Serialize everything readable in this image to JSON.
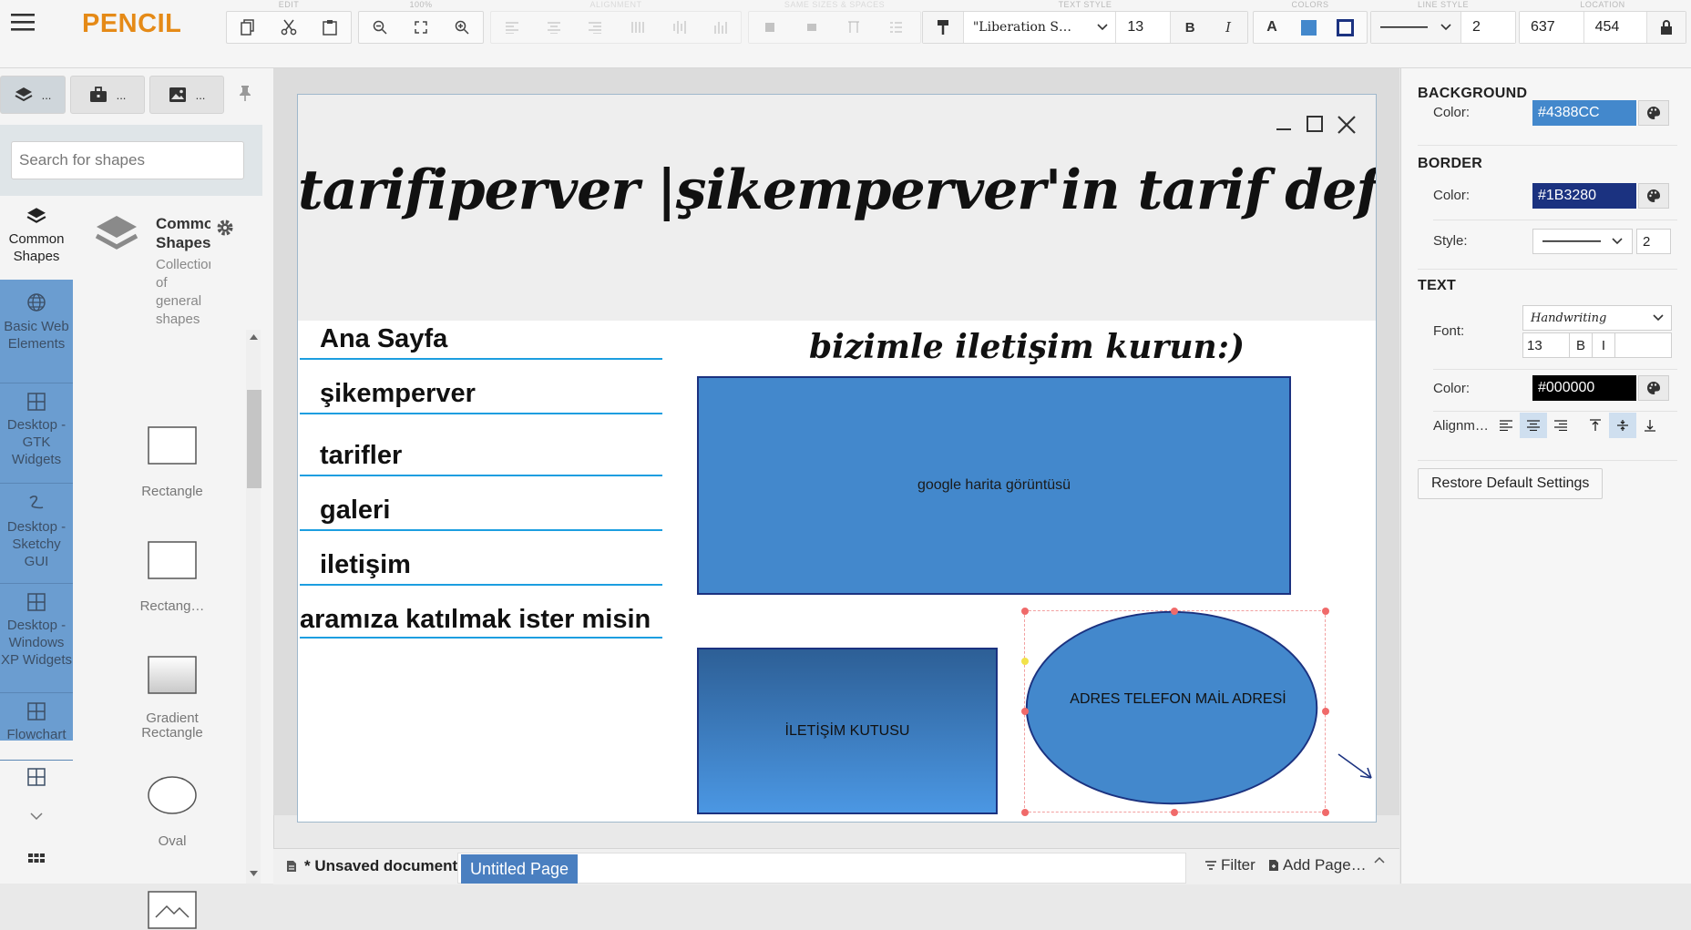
{
  "app": {
    "brand": "PENCIL"
  },
  "toolbar": {
    "captions": {
      "edit": "EDIT",
      "zoom": "100%",
      "alignment": "ALIGNMENT",
      "same_sizes": "SAME SIZES & SPACES",
      "text_style": "TEXT STYLE",
      "colors": "COLORS",
      "line_style": "LINE STYLE",
      "location": "LOCATION"
    },
    "font_family": "\"Liberation S…",
    "font_size": "13",
    "bold": "B",
    "italic": "I",
    "text_color_letter": "A",
    "line_width": "2",
    "location_x": "637",
    "location_y": "454"
  },
  "left_panel": {
    "tabs": [
      {
        "label": "..."
      },
      {
        "label": "..."
      },
      {
        "label": "..."
      }
    ],
    "search_placeholder": "Search for shapes",
    "collection": {
      "title": "Common Shapes",
      "description": "Collection of general shapes"
    },
    "categories": [
      {
        "label": "Common Shapes"
      },
      {
        "label": "Basic Web Elements"
      },
      {
        "label": "Desktop - GTK Widgets"
      },
      {
        "label": "Desktop - Sketchy GUI"
      },
      {
        "label": "Desktop - Windows XP Widgets"
      },
      {
        "label": "Flowchart"
      }
    ],
    "shapes": [
      {
        "label": "Rectangle"
      },
      {
        "label": "Rectang…"
      },
      {
        "label": "Gradient Rectangle"
      },
      {
        "label": "Oval"
      }
    ]
  },
  "canvas": {
    "site_title": "tarifiperver |şikemperver'in tarif defteri",
    "nav": [
      "Ana Sayfa",
      "şikemperver",
      "tarifler",
      "galeri",
      "iletişim",
      "aramıza katılmak ister misin"
    ],
    "contact_heading": "bizimle iletişim kurun:)",
    "map_label": "google harita görüntüsü",
    "contact_box_label": "İLETİŞİM KUTUSU",
    "address_label": "ADRES  TELEFON MAİL ADRESİ"
  },
  "bottom_bar": {
    "document": "* Unsaved document",
    "page_tab": "Untitled Page",
    "filter": "Filter",
    "add_page": "Add Page…"
  },
  "properties": {
    "background": {
      "title": "BACKGROUND",
      "color_label": "Color:",
      "color": "#4388CC"
    },
    "border": {
      "title": "BORDER",
      "color_label": "Color:",
      "color": "#1B3280",
      "style_label": "Style:",
      "width": "2"
    },
    "text": {
      "title": "TEXT",
      "font_label": "Font:",
      "font": "Handwriting",
      "size": "13",
      "bold": "B",
      "italic": "I",
      "color_label": "Color:",
      "color": "#000000",
      "alignment_label": "Alignm…"
    },
    "restore": "Restore Default Settings"
  },
  "colors": {
    "brand": "#e58a17",
    "shape_fill": "#4388cc",
    "shape_border": "#1b3280",
    "nav_underline": "#1c9ee0",
    "accent_tab": "#4a7fc0"
  }
}
